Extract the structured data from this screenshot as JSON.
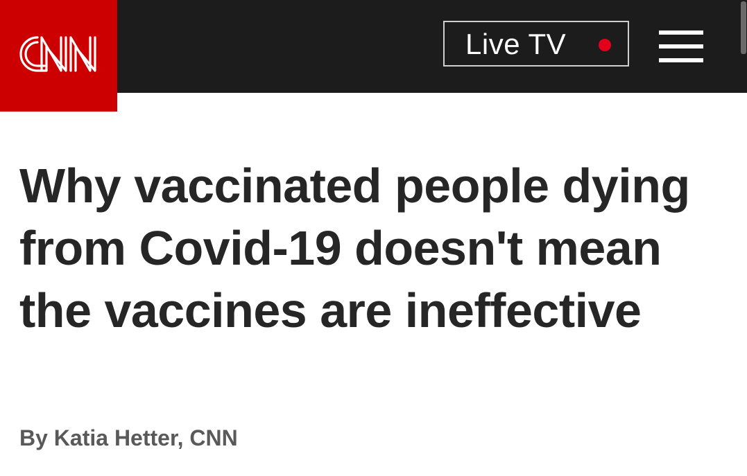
{
  "header": {
    "logo_text": "CNN",
    "live_tv_label": "Live TV",
    "menu_icon": "hamburger-menu-icon",
    "colors": {
      "bar": "#1c1c1c",
      "brand_red": "#cc0000",
      "live_dot": "#e3001b"
    }
  },
  "article": {
    "headline": "Why vaccinated people dying from Covid-19 doesn't mean the vaccines are ineffective",
    "byline": "By Katia Hetter, CNN"
  }
}
